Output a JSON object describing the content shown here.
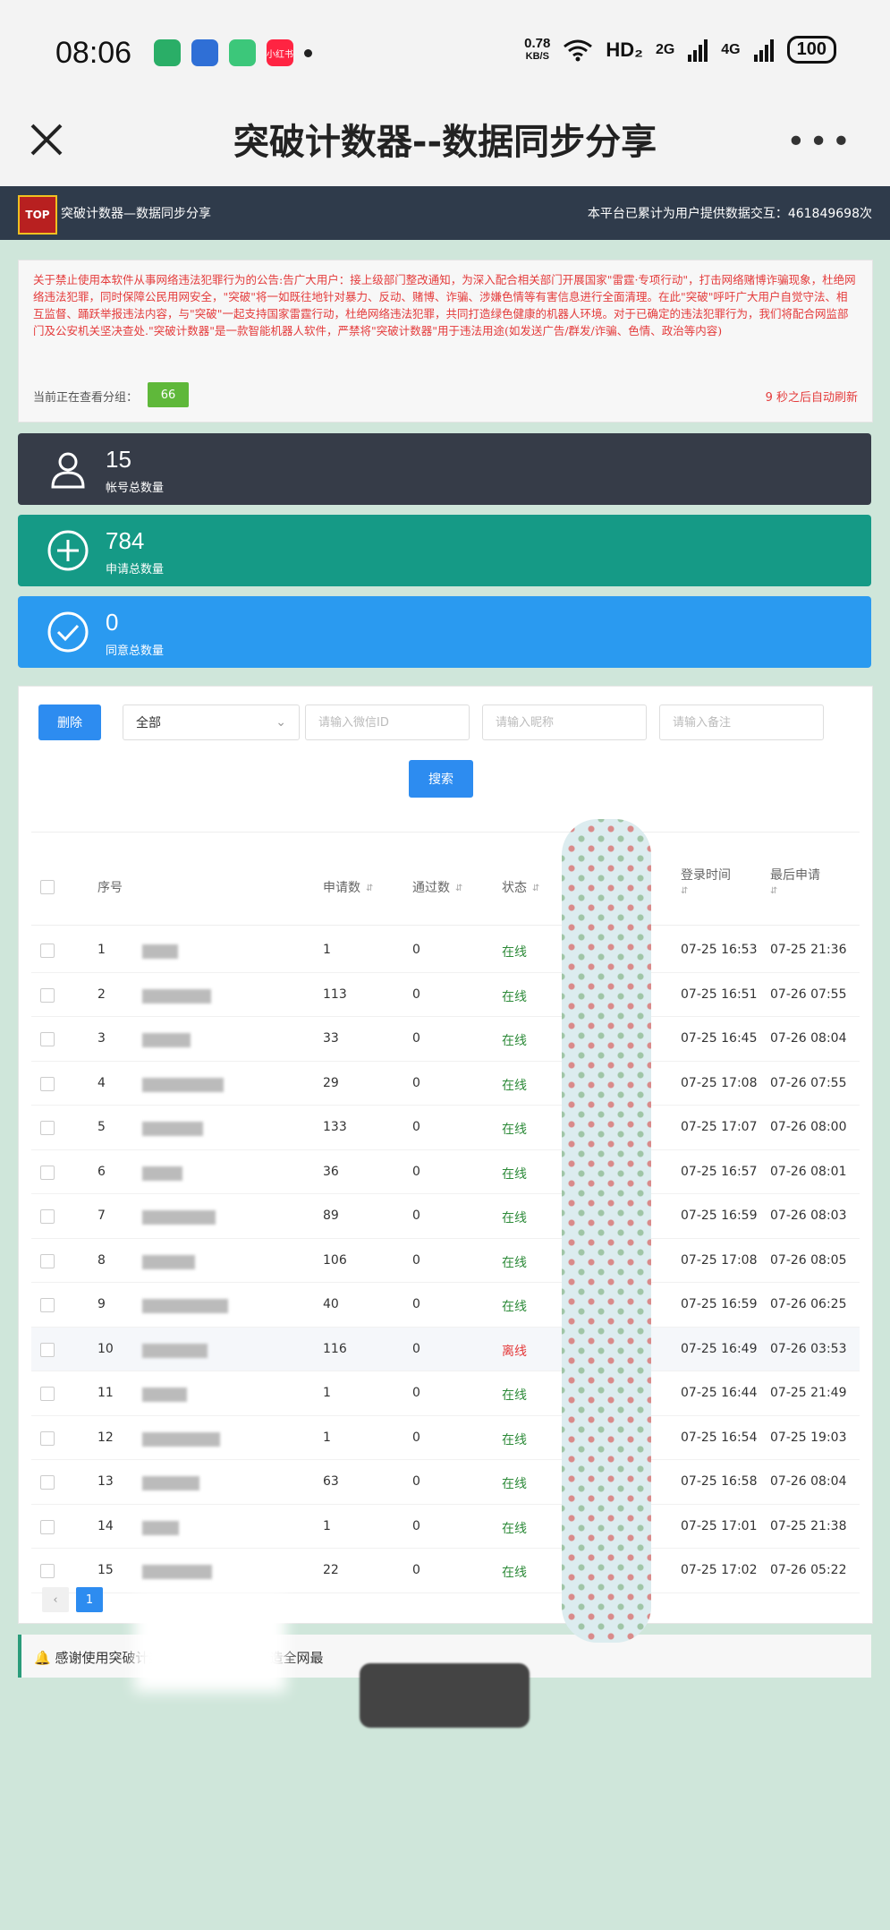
{
  "status_bar": {
    "time": "08:06",
    "apps": [
      {
        "name": "wechat-icon",
        "color": "#2aae67"
      },
      {
        "name": "baidu-icon",
        "color": "#2f6fd6"
      },
      {
        "name": "app-icon",
        "color": "#3cc77a"
      },
      {
        "name": "xiaohongshu-icon",
        "color": "#ff2442",
        "label": "小红书"
      }
    ],
    "speed_value": "0.78",
    "speed_unit": "KB/S",
    "hd": "HD₂",
    "net1": "2G",
    "net2": "4G",
    "battery": "100"
  },
  "nav": {
    "title": "突破计数器--数据同步分享",
    "more": "•••"
  },
  "site": {
    "logo_text": "TOP",
    "name": "突破计数器—数据同步分享",
    "stats": "本平台已累计为用户提供数据交互：461849698次"
  },
  "notice": {
    "text": "关于禁止使用本软件从事网络违法犯罪行为的公告:告广大用户：接上级部门整改通知，为深入配合相关部门开展国家\"雷霆·专项行动\"，打击网络赌博诈骗现象，杜绝网络违法犯罪，同时保障公民用网安全，\"突破\"将一如既往地针对暴力、反动、赌博、诈骗、涉嫌色情等有害信息进行全面清理。在此\"突破\"呼吁广大用户自觉守法、相互监督、踊跃举报违法内容，与\"突破\"一起支持国家雷霆行动，杜绝网络违法犯罪，共同打造绿色健康的机器人环境。对于已确定的违法犯罪行为，我们将配合网监部门及公安机关坚决查处.\"突破计数器\"是一款智能机器人软件，严禁将\"突破计数器\"用于违法用途(如发送广告/群发/诈骗、色情、政治等内容)",
    "group_label": "当前正在查看分组：",
    "group_value": "66",
    "refresh": "9 秒之后自动刷新"
  },
  "cards": [
    {
      "number": "15",
      "label": "帐号总数量",
      "color": "#363c48",
      "icon": "user-icon"
    },
    {
      "number": "784",
      "label": "申请总数量",
      "color": "#159a86",
      "icon": "plus-circle-icon"
    },
    {
      "number": "0",
      "label": "同意总数量",
      "color": "#2a9af0",
      "icon": "check-circle-icon"
    }
  ],
  "toolbar": {
    "delete_label": "删除",
    "select_value": "全部",
    "placeholder_wxid": "请输入微信ID",
    "placeholder_nickname": "请输入昵称",
    "placeholder_remark": "请输入备注",
    "search_label": "搜索"
  },
  "table": {
    "headers": {
      "seq": "序号",
      "apply": "申请数",
      "pass": "通过数",
      "status": "状态",
      "login": "登录时间",
      "last": "最后申请"
    },
    "rows": [
      {
        "seq": "1",
        "apply": "1",
        "pass": "0",
        "status": "在线",
        "online": true,
        "login": "07-25 16:53",
        "last": "07-25 21:36"
      },
      {
        "seq": "2",
        "apply": "113",
        "pass": "0",
        "status": "在线",
        "online": true,
        "login": "07-25 16:51",
        "last": "07-26 07:55"
      },
      {
        "seq": "3",
        "apply": "33",
        "pass": "0",
        "status": "在线",
        "online": true,
        "login": "07-25 16:45",
        "last": "07-26 08:04"
      },
      {
        "seq": "4",
        "apply": "29",
        "pass": "0",
        "status": "在线",
        "online": true,
        "login": "07-25 17:08",
        "last": "07-26 07:55"
      },
      {
        "seq": "5",
        "apply": "133",
        "pass": "0",
        "status": "在线",
        "online": true,
        "login": "07-25 17:07",
        "last": "07-26 08:00"
      },
      {
        "seq": "6",
        "apply": "36",
        "pass": "0",
        "status": "在线",
        "online": true,
        "login": "07-25 16:57",
        "last": "07-26 08:01"
      },
      {
        "seq": "7",
        "apply": "89",
        "pass": "0",
        "status": "在线",
        "online": true,
        "login": "07-25 16:59",
        "last": "07-26 08:03"
      },
      {
        "seq": "8",
        "apply": "106",
        "pass": "0",
        "status": "在线",
        "online": true,
        "login": "07-25 17:08",
        "last": "07-26 08:05"
      },
      {
        "seq": "9",
        "apply": "40",
        "pass": "0",
        "status": "在线",
        "online": true,
        "login": "07-25 16:59",
        "last": "07-26 06:25"
      },
      {
        "seq": "10",
        "apply": "116",
        "pass": "0",
        "status": "离线",
        "online": false,
        "login": "07-25 16:49",
        "last": "07-26 03:53"
      },
      {
        "seq": "11",
        "apply": "1",
        "pass": "0",
        "status": "在线",
        "online": true,
        "login": "07-25 16:44",
        "last": "07-25 21:49"
      },
      {
        "seq": "12",
        "apply": "1",
        "pass": "0",
        "status": "在线",
        "online": true,
        "login": "07-25 16:54",
        "last": "07-25 19:03"
      },
      {
        "seq": "13",
        "apply": "63",
        "pass": "0",
        "status": "在线",
        "online": true,
        "login": "07-25 16:58",
        "last": "07-26 08:04"
      },
      {
        "seq": "14",
        "apply": "1",
        "pass": "0",
        "status": "在线",
        "online": true,
        "login": "07-25 17:01",
        "last": "07-25 21:38"
      },
      {
        "seq": "15",
        "apply": "22",
        "pass": "0",
        "status": "在线",
        "online": true,
        "login": "07-25 17:02",
        "last": "07-26 05:22"
      }
    ]
  },
  "pager": {
    "prev": "‹",
    "current": "1"
  },
  "footer": {
    "thanks_start": "感谢使用突破计数器，我",
    "thanks_end": "打造全网最"
  }
}
